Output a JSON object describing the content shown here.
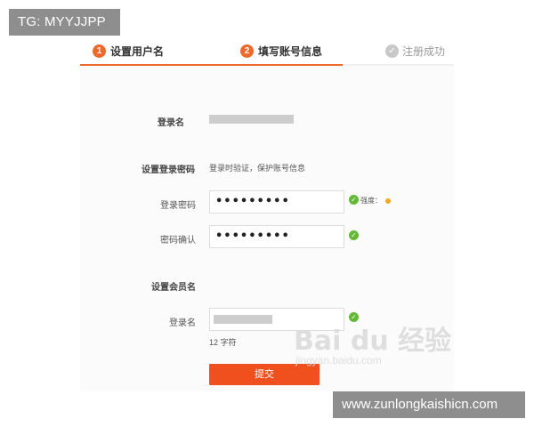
{
  "overlay": {
    "tag_text": "TG: MYYJJPP",
    "site_text": "www.zunlongkaishicn.com"
  },
  "steps": [
    {
      "num": "1",
      "label": "设置用户名"
    },
    {
      "num": "2",
      "label": "填写账号信息"
    },
    {
      "icon": "✓",
      "label": "注册成功"
    }
  ],
  "form": {
    "username_label": "登录名",
    "password_section_label": "设置登录密码",
    "password_hint": "登录时验证，保护账号信息",
    "password_label": "登录密码",
    "password_value": "•••••••••",
    "strength_label": "强度：",
    "confirm_label": "密码确认",
    "confirm_value": "•••••••••",
    "member_section_label": "设置会员名",
    "member_name_label": "登录名",
    "char_count": "12 字符",
    "submit_label": "提交"
  },
  "watermark": {
    "brand": "Bai du 经验",
    "url": "jingyan.baidu.com"
  },
  "colors": {
    "accent": "#ec6a2c",
    "button": "#f0501e",
    "success": "#63b936",
    "strength": "#f5a623"
  }
}
